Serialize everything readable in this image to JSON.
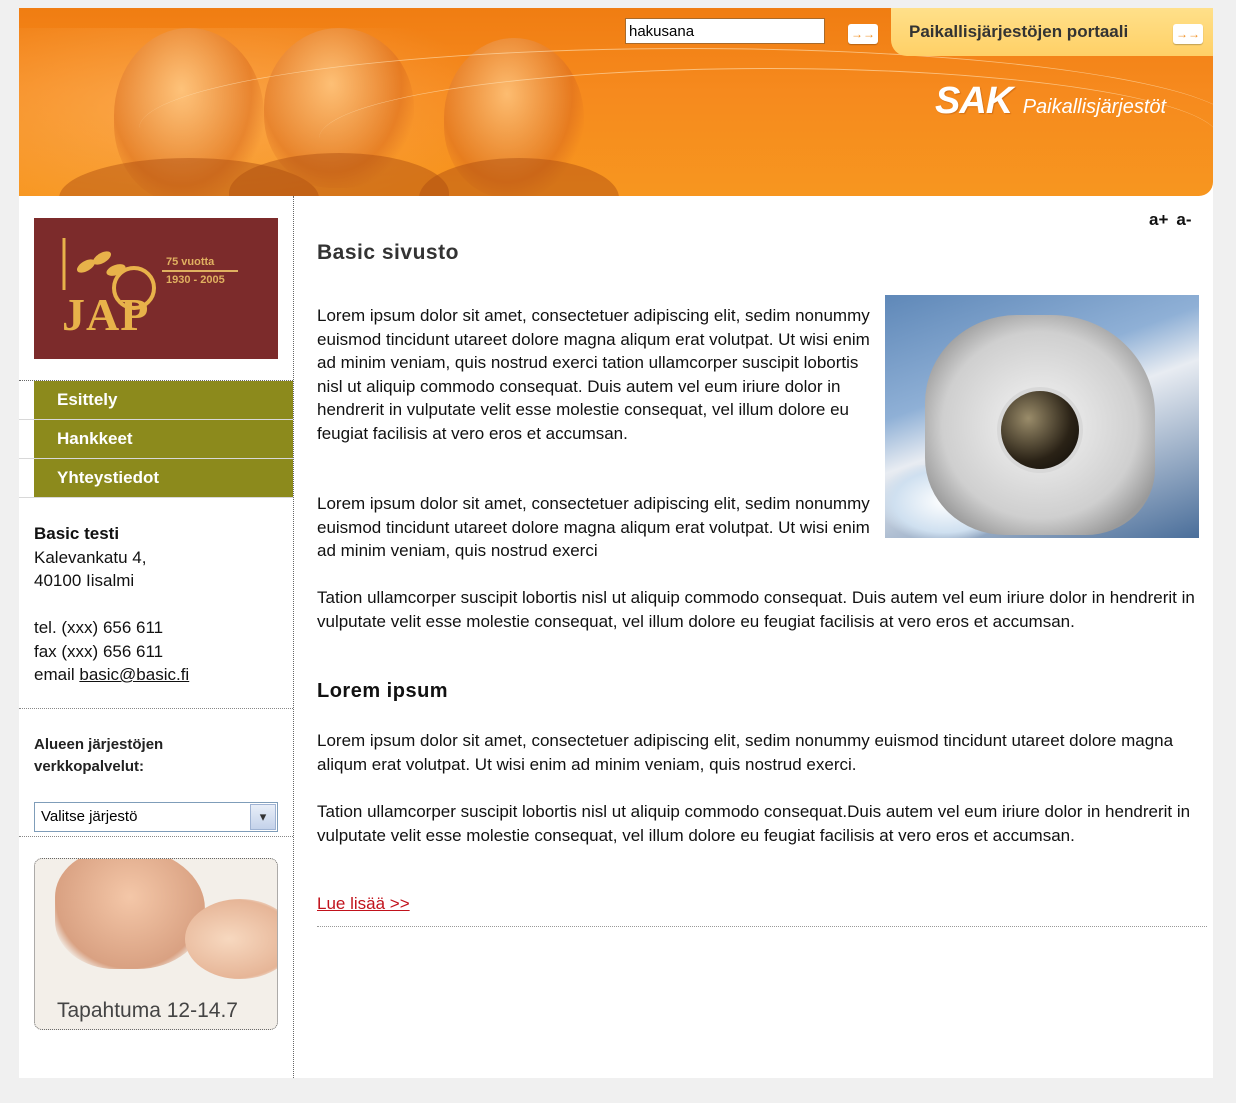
{
  "header": {
    "search_placeholder": "hakusana",
    "search_go": "→→",
    "portal_link": "Paikallisjärjestöjen portaali",
    "portal_go": "→→",
    "brand_sak": "SAK",
    "brand_sub": "Paikallisjärjestöt"
  },
  "sidebar": {
    "logo": {
      "text": "JAP",
      "years": "1930 - 2005",
      "anniversary": "75 vuotta"
    },
    "nav": [
      {
        "label": "Esittely"
      },
      {
        "label": "Hankkeet"
      },
      {
        "label": "Yhteystiedot"
      }
    ],
    "contact": {
      "org": "Basic testi",
      "street": "Kalevankatu 4,",
      "city": "40100 Iisalmi",
      "tel": "tel. (xxx) 656 611",
      "fax": "fax (xxx) 656 611",
      "email_label": "email",
      "email": "basic@basic.fi"
    },
    "services_label": "Alueen järjestöjen verkkopalvelut:",
    "select_value": "Valitse järjestö",
    "select_arrow": "▾",
    "event_caption": "Tapahtuma 12-14.7"
  },
  "main": {
    "font_up": "a+",
    "font_down": "a-",
    "title": "Basic sivusto",
    "paragraph1": "Lorem ipsum dolor sit amet, consectetuer adipiscing elit, sedim nonummy euismod tincidunt utareet dolore magna aliqum erat volutpat. Ut wisi enim ad minim veniam, quis nostrud exerci tation ullamcorper suscipit lobortis nisl ut aliquip commodo consequat. Duis autem vel eum iriure dolor in hendrerit in vulputate velit esse molestie consequat, vel illum dolore eu feugiat facilisis at vero eros et accumsan.",
    "paragraph2": "Lorem ipsum dolor sit amet, consectetuer adipiscing elit, sedim nonummy euismod tincidunt utareet dolore magna aliqum erat volutpat. Ut wisi enim ad minim veniam, quis nostrud exerci",
    "paragraph3": "Tation ullamcorper suscipit lobortis nisl ut aliquip commodo consequat. Duis autem vel eum iriure dolor in hendrerit in vulputate velit esse molestie consequat, vel illum dolore eu feugiat facilisis at vero eros et accumsan.",
    "subheading": "Lorem ipsum",
    "paragraph4": "Lorem ipsum dolor sit amet, consectetuer adipiscing elit, sedim nonummy euismod tincidunt utareet dolore magna aliqum erat volutpat. Ut wisi enim ad minim veniam, quis nostrud exerci.",
    "paragraph5": "Tation ullamcorper suscipit lobortis nisl ut aliquip commodo consequat.Duis autem vel eum iriure dolor in hendrerit in vulputate velit esse molestie consequat, vel illum dolore eu feugiat facilisis at vero eros et accumsan.",
    "read_more": "Lue lisää >>"
  },
  "colors": {
    "header_orange": "#f68a1e",
    "nav_olive": "#8c8a1c",
    "logo_maroon": "#7c2b2b",
    "link_red": "#c1121b"
  }
}
